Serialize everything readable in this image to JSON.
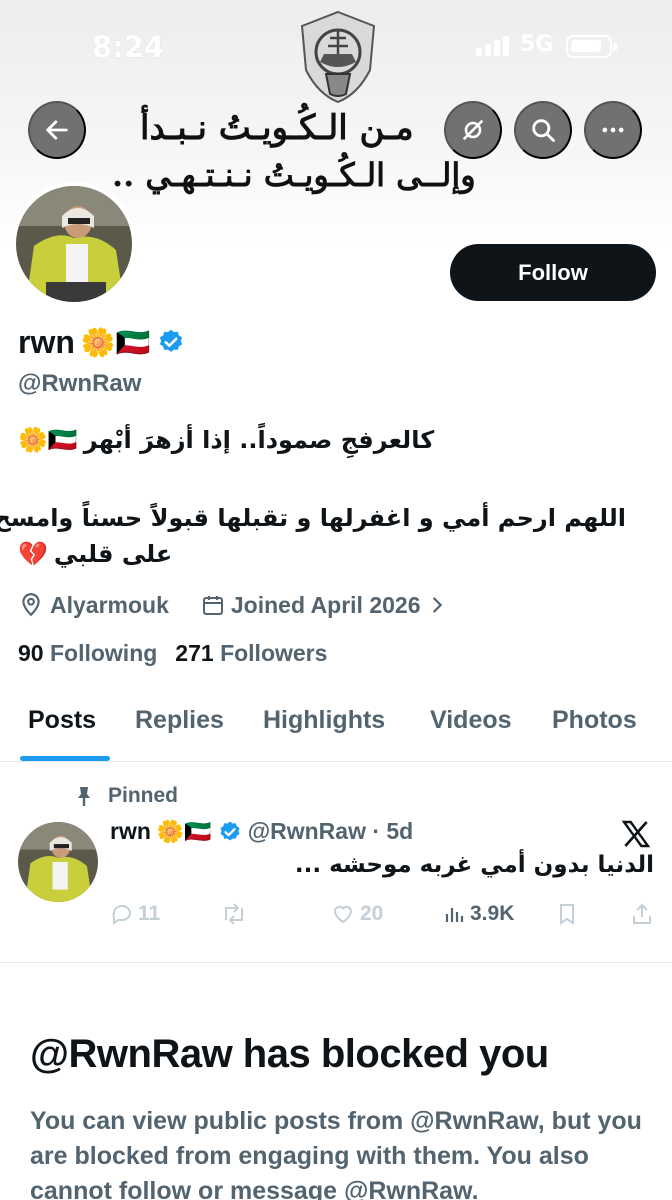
{
  "status_bar": {
    "time": "8:24",
    "network": "5G"
  },
  "banner": {
    "line1": "مـن الـكُـويـتُ نـبـدأ",
    "line2": "وإلــى الـكُـويـتُ نـنـتـهـي .."
  },
  "profile": {
    "display_name": "rwn",
    "name_emojis": "🌼🇰🇼",
    "handle": "@RwnRaw",
    "follow_label": "Follow",
    "bio_line1": "كالعرفجِ صموداً.. إذا أزهرَ أبْهر",
    "bio_line1_emojis": "🌼🇰🇼",
    "bio_line2": "اللهم ارحم أمي و اغفرلها و تقبلها قبولاً حسناً وامسح",
    "bio_line3": "على قلبي",
    "bio_line3_emoji": "💔",
    "location": "Alyarmouk",
    "joined": "Joined April 2026",
    "following_count": "90",
    "following_label": "Following",
    "followers_count": "271",
    "followers_label": "Followers"
  },
  "tabs": [
    "Posts",
    "Replies",
    "Highlights",
    "Videos",
    "Photos"
  ],
  "active_tab": "Posts",
  "pinned_post": {
    "pinned_label": "Pinned",
    "name": "rwn",
    "name_emojis": "🌼🇰🇼",
    "handle_time": "@RwnRaw · 5d",
    "text": "الدنيا بدون أمي غربه موحشه ...",
    "replies": "11",
    "likes": "20",
    "views": "3.9K"
  },
  "blocked": {
    "title": "@RwnRaw has blocked you",
    "message": "You can view public posts from @RwnRaw, but you are blocked from engaging with them. You also cannot follow or message @RwnRaw."
  },
  "colors": {
    "accent": "#1d9bf0",
    "text": "#0f1419",
    "muted": "#536471",
    "verified": "#1d9bf0"
  },
  "icons": [
    "back-arrow-icon",
    "spam-icon",
    "search-icon",
    "more-icon",
    "verified-badge-icon",
    "location-pin-icon",
    "calendar-icon",
    "chevron-right-icon",
    "pin-icon",
    "x-logo-icon",
    "reply-icon",
    "retweet-icon",
    "like-icon",
    "views-icon",
    "bookmark-icon",
    "share-icon"
  ]
}
